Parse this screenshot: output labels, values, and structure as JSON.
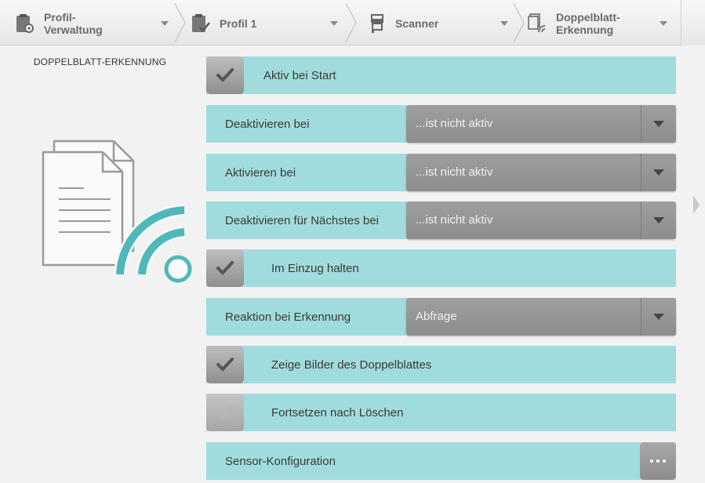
{
  "breadcrumb": [
    {
      "label": "Profil-\nVerwaltung",
      "icon": "profile-admin-icon"
    },
    {
      "label": "Profil 1",
      "icon": "clipboard-check-icon"
    },
    {
      "label": "Scanner",
      "icon": "scanner-icon"
    },
    {
      "label": "Doppelblatt-\nErkennung",
      "icon": "double-sheet-icon"
    }
  ],
  "section_title": "DOPPELBLATT-ERKENNUNG",
  "rows": {
    "aktiv_bei_start": {
      "label": "Aktiv bei Start",
      "checked": true
    },
    "deaktivieren_bei": {
      "label": "Deaktivieren bei",
      "value": "...ist nicht aktiv"
    },
    "aktivieren_bei": {
      "label": "Aktivieren bei",
      "value": "...ist nicht aktiv"
    },
    "deaktivieren_naechstes": {
      "label": "Deaktivieren für Nächstes bei",
      "value": "...ist nicht aktiv"
    },
    "im_einzug_halten": {
      "label": "Im Einzug halten",
      "checked": true
    },
    "reaktion": {
      "label": "Reaktion bei Erkennung",
      "value": "Abfrage"
    },
    "zeige_bilder": {
      "label": "Zeige Bilder des Doppelblattes",
      "checked": true
    },
    "fortsetzen": {
      "label": "Fortsetzen nach Löschen",
      "checked": false
    },
    "sensor": {
      "label": "Sensor-Konfiguration",
      "button": "..."
    }
  },
  "colors": {
    "row": "#a0dcdd",
    "accent": "#4fb8b9",
    "control": "#8f8f8f"
  }
}
